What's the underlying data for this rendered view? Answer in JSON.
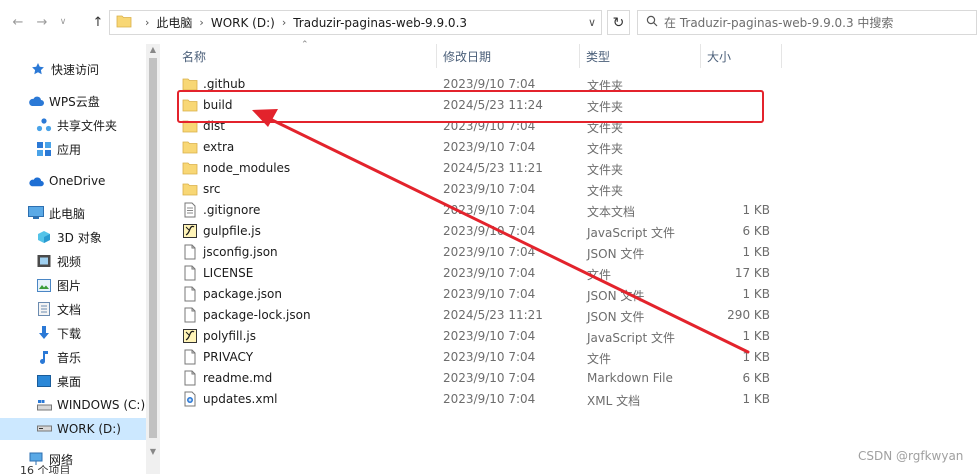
{
  "address": {
    "crumbs": [
      "此电脑",
      "WORK (D:)",
      "Traduzir-paginas-web-9.9.0.3"
    ],
    "search_placeholder": "在 Traduzir-paginas-web-9.9.0.3 中搜索"
  },
  "nav": {
    "items": [
      {
        "label": "快速访问",
        "icon": "quick-access-star-icon"
      },
      {
        "label": "WPS云盘",
        "icon": "wps-cloud-icon"
      },
      {
        "label": "共享文件夹",
        "icon": "shared-folder-icon"
      },
      {
        "label": "应用",
        "icon": "apps-icon"
      },
      {
        "label": "OneDrive",
        "icon": "onedrive-cloud-icon"
      },
      {
        "label": "此电脑",
        "icon": "this-pc-icon"
      },
      {
        "label": "3D 对象",
        "icon": "3d-objects-icon"
      },
      {
        "label": "视频",
        "icon": "video-icon"
      },
      {
        "label": "图片",
        "icon": "pictures-icon"
      },
      {
        "label": "文档",
        "icon": "documents-icon"
      },
      {
        "label": "下载",
        "icon": "download-icon"
      },
      {
        "label": "音乐",
        "icon": "music-icon"
      },
      {
        "label": "桌面",
        "icon": "desktop-icon"
      },
      {
        "label": "WINDOWS (C:)",
        "icon": "drive-c-icon"
      },
      {
        "label": "WORK (D:)",
        "icon": "drive-d-icon"
      },
      {
        "label": "网络",
        "icon": "network-icon"
      }
    ],
    "selected": "WORK (D:)"
  },
  "status": {
    "item_count": "16 个项目"
  },
  "columns": {
    "name": "名称",
    "date": "修改日期",
    "type": "类型",
    "size": "大小"
  },
  "files": [
    {
      "name": ".github",
      "date": "2023/9/10 7:04",
      "type": "文件夹",
      "size": "",
      "icon": "folder-icon"
    },
    {
      "name": "build",
      "date": "2024/5/23 11:24",
      "type": "文件夹",
      "size": "",
      "icon": "folder-icon"
    },
    {
      "name": "dist",
      "date": "2023/9/10 7:04",
      "type": "文件夹",
      "size": "",
      "icon": "folder-icon"
    },
    {
      "name": "extra",
      "date": "2023/9/10 7:04",
      "type": "文件夹",
      "size": "",
      "icon": "folder-icon"
    },
    {
      "name": "node_modules",
      "date": "2024/5/23 11:21",
      "type": "文件夹",
      "size": "",
      "icon": "folder-icon"
    },
    {
      "name": "src",
      "date": "2023/9/10 7:04",
      "type": "文件夹",
      "size": "",
      "icon": "folder-icon"
    },
    {
      "name": ".gitignore",
      "date": "2023/9/10 7:04",
      "type": "文本文档",
      "size": "1 KB",
      "icon": "text-file-icon"
    },
    {
      "name": "gulpfile.js",
      "date": "2023/9/10 7:04",
      "type": "JavaScript 文件",
      "size": "6 KB",
      "icon": "script-file-icon"
    },
    {
      "name": "jsconfig.json",
      "date": "2023/9/10 7:04",
      "type": "JSON 文件",
      "size": "1 KB",
      "icon": "blank-file-icon"
    },
    {
      "name": "LICENSE",
      "date": "2023/9/10 7:04",
      "type": "文件",
      "size": "17 KB",
      "icon": "blank-file-icon"
    },
    {
      "name": "package.json",
      "date": "2023/9/10 7:04",
      "type": "JSON 文件",
      "size": "1 KB",
      "icon": "blank-file-icon"
    },
    {
      "name": "package-lock.json",
      "date": "2024/5/23 11:21",
      "type": "JSON 文件",
      "size": "290 KB",
      "icon": "blank-file-icon"
    },
    {
      "name": "polyfill.js",
      "date": "2023/9/10 7:04",
      "type": "JavaScript 文件",
      "size": "1 KB",
      "icon": "script-file-icon"
    },
    {
      "name": "PRIVACY",
      "date": "2023/9/10 7:04",
      "type": "文件",
      "size": "1 KB",
      "icon": "blank-file-icon"
    },
    {
      "name": "readme.md",
      "date": "2023/9/10 7:04",
      "type": "Markdown File",
      "size": "6 KB",
      "icon": "blank-file-icon"
    },
    {
      "name": "updates.xml",
      "date": "2023/9/10 7:04",
      "type": "XML 文档",
      "size": "1 KB",
      "icon": "xml-file-icon"
    }
  ],
  "colors": {
    "annotation_red": "#e3232c",
    "selected_bg": "#cce8ff",
    "folder_yellow": "#f8d775"
  },
  "watermark": "CSDN @rgfkwyan"
}
